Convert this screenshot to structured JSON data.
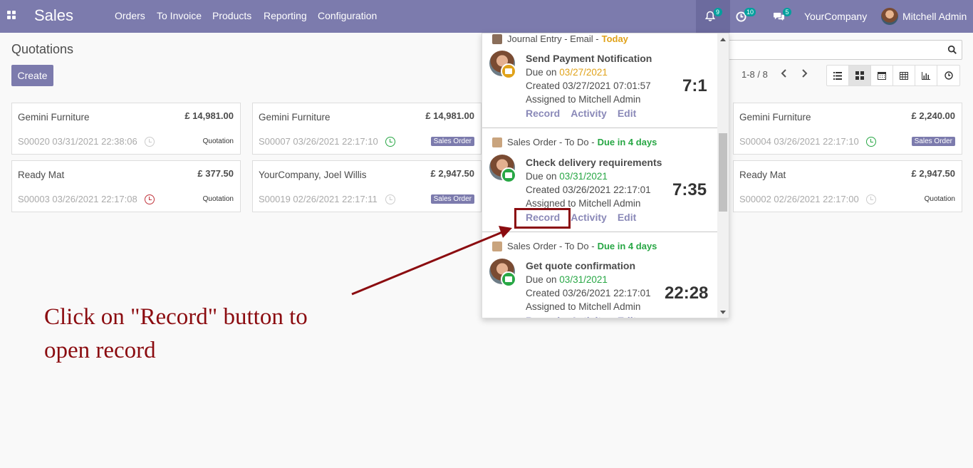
{
  "navbar": {
    "app_name": "Sales",
    "menu": [
      "Orders",
      "To Invoice",
      "Products",
      "Reporting",
      "Configuration"
    ],
    "notifications_count": "9",
    "activities_count": "10",
    "messages_count": "5",
    "company": "YourCompany",
    "user": "Mitchell Admin"
  },
  "control_panel": {
    "title": "Quotations",
    "create_label": "Create",
    "pager": "1-8 / 8"
  },
  "cards": [
    {
      "name": "Gemini Furniture",
      "amount": "£ 14,981.00",
      "ref": "S00020 03/31/2021 22:38:06",
      "clock": "grey",
      "state": "Quotation"
    },
    {
      "name": "Gemini Furniture",
      "amount": "£ 14,981.00",
      "ref": "S00007 03/26/2021 22:17:10",
      "clock": "green",
      "state": "Sales Order"
    },
    {
      "name": "Gemini Furniture",
      "amount": "£ 2,240.00",
      "ref": "S00004 03/26/2021 22:17:10",
      "clock": "green",
      "state": "Sales Order"
    },
    {
      "name": "Ready Mat",
      "amount": "£ 377.50",
      "ref": "S00003 03/26/2021 22:17:08",
      "clock": "red",
      "state": "Quotation"
    },
    {
      "name": "YourCompany, Joel Willis",
      "amount": "£ 2,947.50",
      "ref": "S00019 02/26/2021 22:17:11",
      "clock": "grey",
      "state": "Sales Order"
    },
    {
      "name": "Ready Mat",
      "amount": "£ 2,947.50",
      "ref": "S00002 02/26/2021 22:17:00",
      "clock": "grey",
      "state": "Quotation"
    }
  ],
  "activities": [
    {
      "header": "Journal Entry - Email - ",
      "due": "Today",
      "summary": "Send Payment Notification",
      "due_label": "Due on ",
      "due_date": "03/27/2021",
      "created": "Created 03/27/2021 07:01:57",
      "assigned": "Assigned to Mitchell Admin",
      "timer": "7:1"
    },
    {
      "header": "Sales Order - To Do - ",
      "due": "Due in 4 days",
      "summary": "Check delivery requirements",
      "due_label": "Due on ",
      "due_date": "03/31/2021",
      "created": "Created 03/26/2021 22:17:01",
      "assigned": "Assigned to Mitchell Admin",
      "timer": "7:35"
    },
    {
      "header": "Sales Order - To Do - ",
      "due": "Due in 4 days",
      "summary": "Get quote confirmation",
      "due_label": "Due on ",
      "due_date": "03/31/2021",
      "created": "Created 03/26/2021 22:17:01",
      "assigned": "Assigned to Mitchell Admin",
      "timer": "22:28"
    }
  ],
  "activity_links": {
    "record": "Record",
    "activity": "Activity",
    "edit": "Edit"
  },
  "annotation": {
    "line1": "Click on \"Record\" button to",
    "line2": "open record"
  },
  "colors": {
    "brand": "#7c7bad",
    "annotation": "#8b0c10",
    "due_today": "#e0a21a",
    "due_days": "#28a745"
  }
}
